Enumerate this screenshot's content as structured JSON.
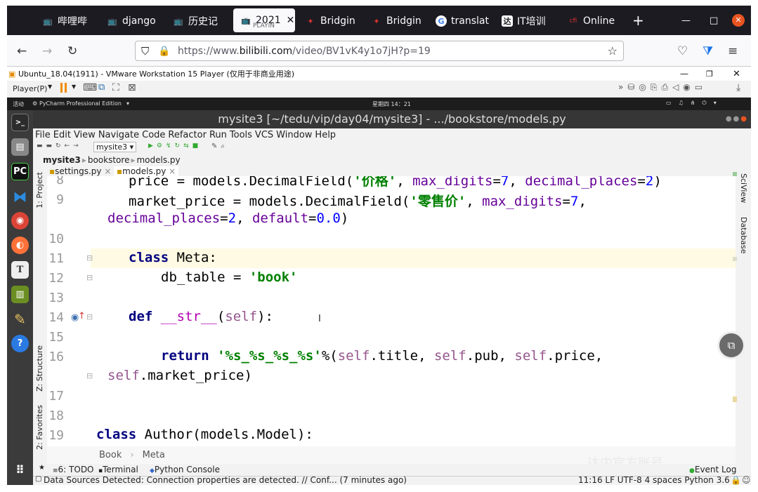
{
  "browser": {
    "tabs": [
      {
        "label": "哔哩哔"
      },
      {
        "label": "django"
      },
      {
        "label": "历史记"
      },
      {
        "label": "2021",
        "sub": "PLAYIN"
      },
      {
        "label": "Bridgin"
      },
      {
        "label": "Bridgin"
      },
      {
        "label": "translat"
      },
      {
        "label": "IT培训"
      },
      {
        "label": "Online"
      }
    ],
    "url": "https://www.bilibili.com/video/BV1vK4y1o7jH?p=19",
    "url_host_prefix": "https://www.",
    "url_host": "bilibili.com",
    "url_path": "/video/BV1vK4y1o7jH?p=19"
  },
  "vmware": {
    "title": "Ubuntu_18.04(1911) - VMware Workstation 15 Player (仅用于非商业用途)",
    "player_menu": "Player(P)"
  },
  "ubuntu": {
    "activities": "活动",
    "app": "PyCharm Professional Edition",
    "clock": "星期四 14：21"
  },
  "pycharm": {
    "title": "mysite3 [~/tedu/vip/day04/mysite3] - .../bookstore/models.py",
    "menu": [
      "File",
      "Edit",
      "View",
      "Navigate",
      "Code",
      "Refactor",
      "Run",
      "Tools",
      "VCS",
      "Window",
      "Help"
    ],
    "run_config": "mysite3",
    "breadcrumb": [
      "mysite3",
      "bookstore",
      "models.py"
    ],
    "file_tabs": [
      "settings.py",
      "models.py"
    ],
    "left_tools": [
      "1: Project",
      "Z: Structure",
      "2: Favorites"
    ],
    "right_tools": [
      "SciView",
      "Database"
    ],
    "line_numbers": [
      "8",
      "9",
      "10",
      "11",
      "12",
      "13",
      "14",
      "15",
      "16",
      "17",
      "18",
      "19"
    ],
    "editor_crumb": [
      "Book",
      "Meta"
    ],
    "bottom_tools": [
      "6: TODO",
      "Terminal",
      "Python Console"
    ],
    "event_log": "Event Log",
    "status_msg": "Data Sources Detected: Connection properties are detected. // Conf... (7 minutes ago)",
    "status_right": "11:16  LF  UTF-8  4 spaces  Python 3.6"
  },
  "watermark": "达内官方账号"
}
